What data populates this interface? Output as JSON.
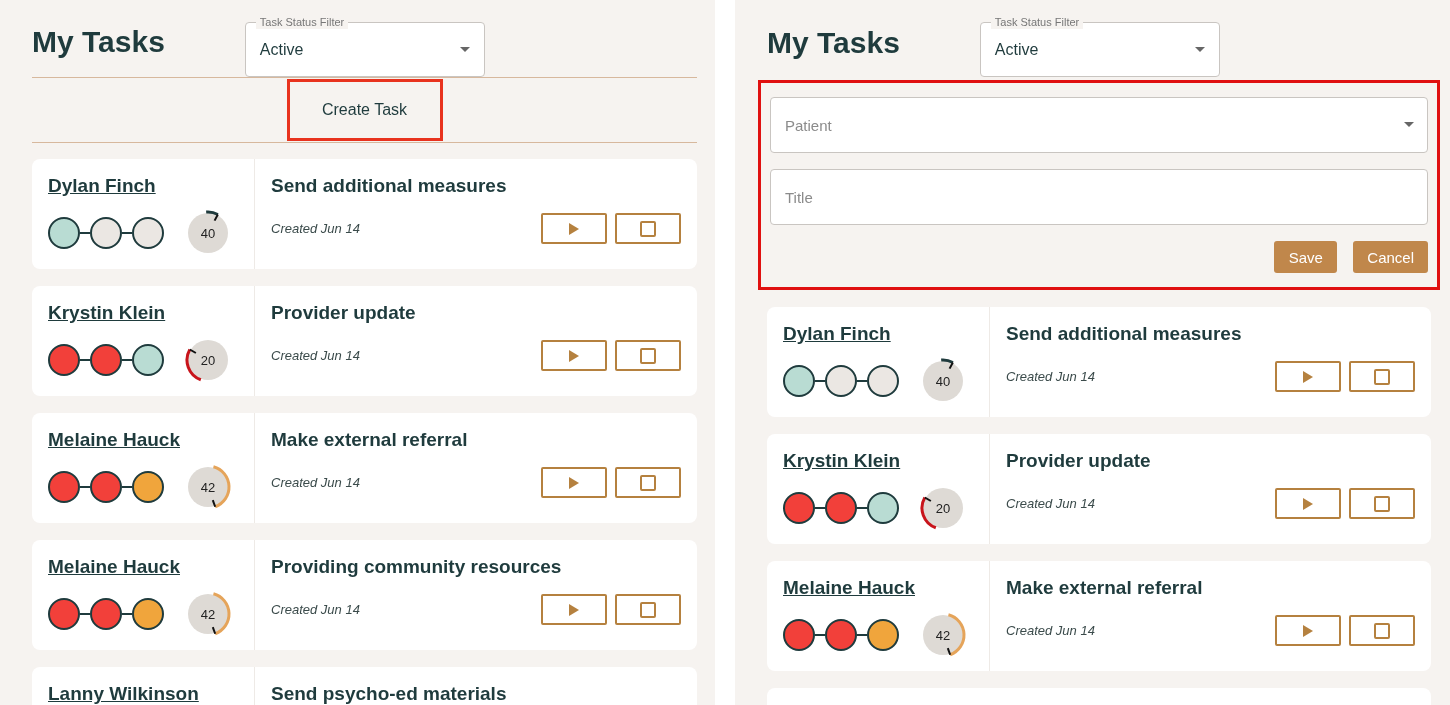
{
  "panels": [
    {
      "title": "My Tasks",
      "filter": {
        "label": "Task Status Filter",
        "value": "Active"
      },
      "create_button": {
        "label": "Create Task",
        "highlighted": true
      },
      "tasks": [
        {
          "kind": "full",
          "patient": "Dylan Finch",
          "dots": [
            {
              "color": "#b9dcd3"
            },
            {
              "color": "#ebe7e3"
            },
            {
              "color": "#ebe7e3"
            }
          ],
          "gauge": {
            "score": "40",
            "color": "#1f3b3d",
            "kind": "top"
          },
          "title": "Send additional measures",
          "created": "Created Jun 14"
        },
        {
          "kind": "full",
          "patient": "Krystin Klein",
          "dots": [
            {
              "color": "#f2403a"
            },
            {
              "color": "#f2403a"
            },
            {
              "color": "#b9dcd3"
            }
          ],
          "gauge": {
            "score": "20",
            "color": "#c8141b",
            "kind": "left"
          },
          "title": "Provider update",
          "created": "Created Jun 14"
        },
        {
          "kind": "full",
          "patient": "Melaine Hauck",
          "dots": [
            {
              "color": "#f2403a"
            },
            {
              "color": "#f2403a"
            },
            {
              "color": "#f0a53c"
            }
          ],
          "gauge": {
            "score": "42",
            "color": "#e5a45a",
            "kind": "right"
          },
          "title": "Make external referral",
          "created": "Created Jun 14"
        },
        {
          "kind": "full",
          "patient": "Melaine Hauck",
          "dots": [
            {
              "color": "#f2403a"
            },
            {
              "color": "#f2403a"
            },
            {
              "color": "#f0a53c"
            }
          ],
          "gauge": {
            "score": "42",
            "color": "#e5a45a",
            "kind": "right"
          },
          "title": "Providing community resources",
          "created": "Created Jun 14"
        },
        {
          "kind": "partial",
          "patient": "Lanny Wilkinson",
          "title": "Send psycho-ed materials"
        }
      ]
    },
    {
      "title": "My Tasks",
      "filter": {
        "label": "Task Status Filter",
        "value": "Active"
      },
      "create_form": {
        "highlighted": true,
        "patient": {
          "placeholder": "Patient"
        },
        "title_field": {
          "placeholder": "Title"
        },
        "buttons": [
          "Save",
          "Cancel"
        ]
      },
      "tasks": [
        {
          "kind": "full",
          "patient": "Dylan Finch",
          "dots": [
            {
              "color": "#b9dcd3"
            },
            {
              "color": "#ebe7e3"
            },
            {
              "color": "#ebe7e3"
            }
          ],
          "gauge": {
            "score": "40",
            "color": "#1f3b3d",
            "kind": "top"
          },
          "title": "Send additional measures",
          "created": "Created Jun 14"
        },
        {
          "kind": "full",
          "patient": "Krystin Klein",
          "dots": [
            {
              "color": "#f2403a"
            },
            {
              "color": "#f2403a"
            },
            {
              "color": "#b9dcd3"
            }
          ],
          "gauge": {
            "score": "20",
            "color": "#c8141b",
            "kind": "left"
          },
          "title": "Provider update",
          "created": "Created Jun 14"
        },
        {
          "kind": "full",
          "patient": "Melaine Hauck",
          "dots": [
            {
              "color": "#f2403a"
            },
            {
              "color": "#f2403a"
            },
            {
              "color": "#f0a53c"
            }
          ],
          "gauge": {
            "score": "42",
            "color": "#e5a45a",
            "kind": "right"
          },
          "title": "Make external referral",
          "created": "Created Jun 14"
        },
        {
          "kind": "empty"
        }
      ]
    }
  ]
}
